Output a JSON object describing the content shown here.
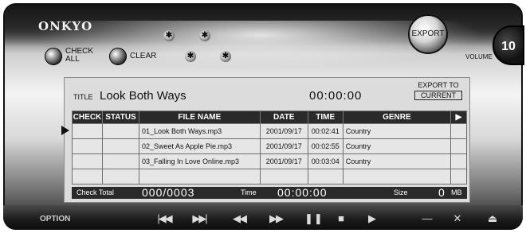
{
  "brand": "ONKYO",
  "buttons": {
    "check_all": "CHECK\nALL",
    "clear": "CLEAR",
    "export": "EXPORT",
    "export_to": "EXPORT TO",
    "export_target": "CURRENT",
    "option": "OPTION"
  },
  "volume": {
    "label": "VOLUME",
    "value": "10"
  },
  "now_playing": {
    "title_label": "TITLE",
    "title": "Look Both Ways",
    "time": "00:00:00"
  },
  "table": {
    "columns": [
      "CHECK",
      "STATUS",
      "FILE NAME",
      "DATE",
      "TIME",
      "GENRE"
    ],
    "rows": [
      {
        "check": "",
        "status": "",
        "file_name": "01_Look Both Ways.mp3",
        "date": "2001/09/17",
        "time": "00:02:41",
        "genre": "Country"
      },
      {
        "check": "",
        "status": "",
        "file_name": "02_Sweet As Apple Pie.mp3",
        "date": "2001/09/17",
        "time": "00:02:55",
        "genre": "Country"
      },
      {
        "check": "",
        "status": "",
        "file_name": "03_Falling In Love Online.mp3",
        "date": "2001/09/17",
        "time": "00:03:04",
        "genre": "Country"
      },
      {
        "check": "",
        "status": "",
        "file_name": "",
        "date": "",
        "time": "",
        "genre": ""
      }
    ]
  },
  "footer": {
    "check_total_label": "Check Total",
    "check_total_value": "000/0003",
    "time_label": "Time",
    "time_value": "00:00:00",
    "size_label": "Size",
    "size_value": "0",
    "size_unit": "MB"
  },
  "icons": {
    "small_controls": [
      "hex-nut-icon",
      "hex-nut-icon",
      "hex-nut-icon",
      "hex-nut-icon"
    ],
    "transport": [
      "skip-previous-icon",
      "skip-next-icon",
      "rewind-icon",
      "fast-forward-icon",
      "pause-icon",
      "stop-icon",
      "play-icon",
      "minimize-icon",
      "close-icon",
      "eject-icon"
    ]
  }
}
